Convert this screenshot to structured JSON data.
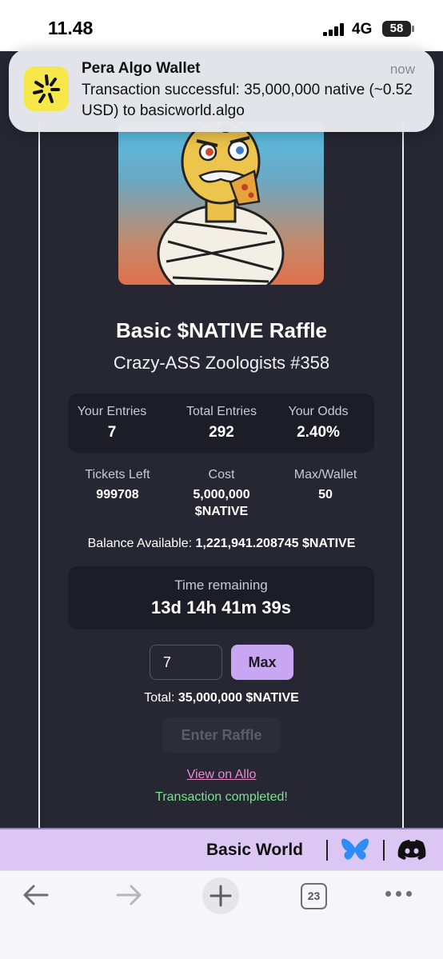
{
  "status_bar": {
    "time": "11.48",
    "network": "4G",
    "battery": "58"
  },
  "notification": {
    "app": "Pera Algo Wallet",
    "time": "now",
    "message": "Transaction successful: 35,000,000 native (~0.52 USD) to basicworld.algo"
  },
  "raffle": {
    "title": "Basic $NATIVE Raffle",
    "subtitle": "Crazy-ASS Zoologists #358"
  },
  "stats": {
    "your_entries_label": "Your Entries",
    "your_entries": "7",
    "total_entries_label": "Total Entries",
    "total_entries": "292",
    "your_odds_label": "Your Odds",
    "your_odds": "2.40%"
  },
  "info": {
    "tickets_left_label": "Tickets Left",
    "tickets_left": "999708",
    "cost_label": "Cost",
    "cost_line1": "5,000,000",
    "cost_line2": "$NATIVE",
    "max_wallet_label": "Max/Wallet",
    "max_wallet": "50"
  },
  "balance": {
    "label": "Balance Available:",
    "value": "1,221,941.208745 $NATIVE"
  },
  "timer": {
    "label": "Time remaining",
    "value": "13d 14h 41m 39s"
  },
  "entry": {
    "quantity": "7",
    "max_label": "Max",
    "total_label": "Total:",
    "total_value": "35,000,000 $NATIVE",
    "enter_label": "Enter Raffle"
  },
  "links": {
    "view_on_allo": "View on Allo",
    "status": "Transaction completed!"
  },
  "footer": {
    "brand": "Basic World"
  },
  "browser": {
    "tab_count": "23"
  },
  "colors": {
    "app_background": "#262733",
    "accent_purple": "#c9a6f2",
    "link_pink": "#e98ad0",
    "success_green": "#7be38c",
    "footer_background": "#dcc7f4"
  }
}
